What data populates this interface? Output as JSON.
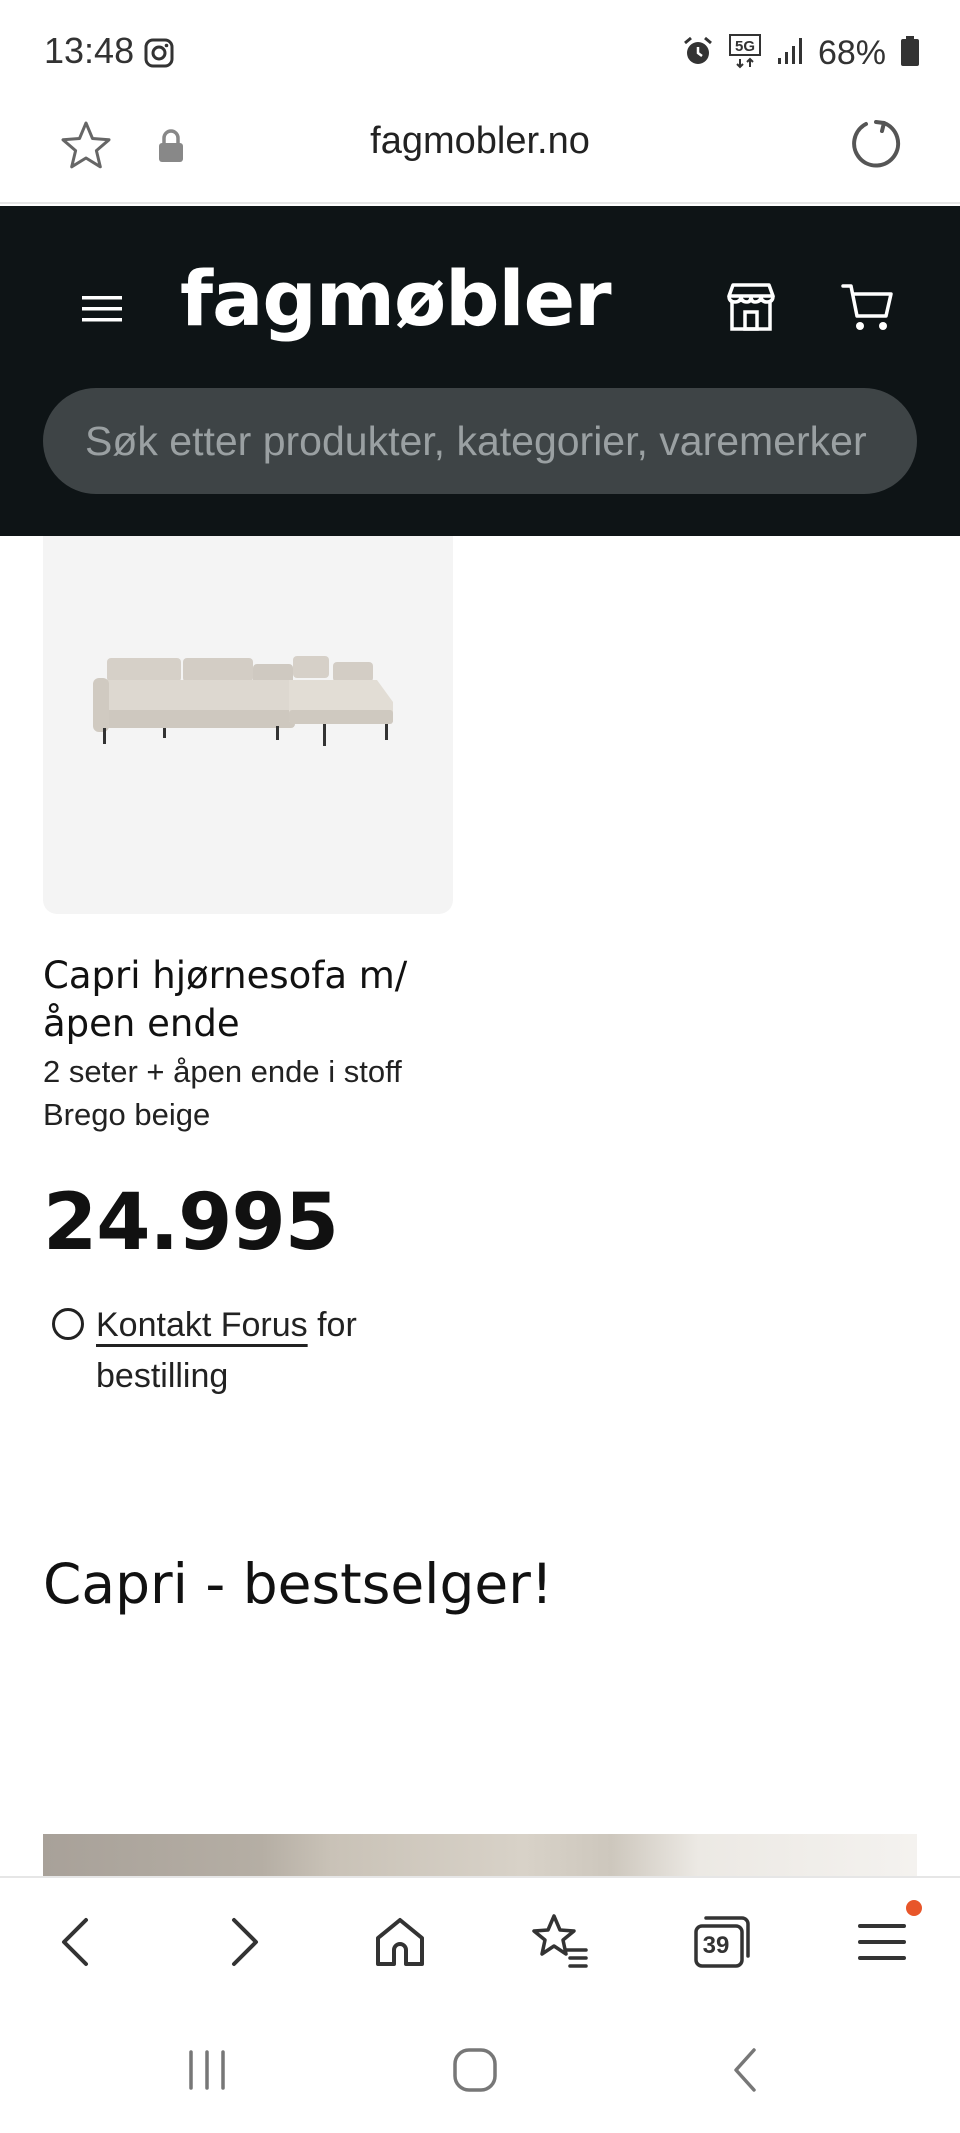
{
  "status_bar": {
    "time": "13:48",
    "network": "5G",
    "battery": "68%",
    "icons": [
      "instagram-icon",
      "alarm-icon",
      "5g-icon",
      "signal-icon",
      "battery-icon"
    ]
  },
  "browser": {
    "url": "fagmobler.no",
    "icons": [
      "star-icon",
      "lock-icon",
      "reload-icon"
    ],
    "toolbar": {
      "tab_count": "39",
      "icons": [
        "back-icon",
        "forward-icon",
        "home-icon",
        "bookmarks-icon",
        "tabs-icon",
        "menu-icon"
      ]
    }
  },
  "site": {
    "logo": "fagmøbler",
    "search_placeholder": "Søk etter produkter, kategorier, varemerker",
    "header_bg": "#0e1416",
    "icons": [
      "hamburger-icon",
      "store-icon",
      "cart-icon"
    ]
  },
  "product": {
    "title": "Capri hjørnesofa m/ åpen ende",
    "description": "2 seter + åpen ende i stoff Brego beige",
    "price": "24.995",
    "availability_link": "Kontakt Forus",
    "availability_suffix": " for bestilling",
    "image_icon": "sofa-image"
  },
  "section": {
    "heading": "Capri - bestselger!"
  },
  "system_nav": {
    "icons": [
      "recents-icon",
      "home-circle-icon",
      "back-chevron-icon"
    ]
  },
  "colors": {
    "accent_dot": "#e8562a",
    "search_bg": "#3e4446",
    "placeholder": "#9aa0a2"
  }
}
